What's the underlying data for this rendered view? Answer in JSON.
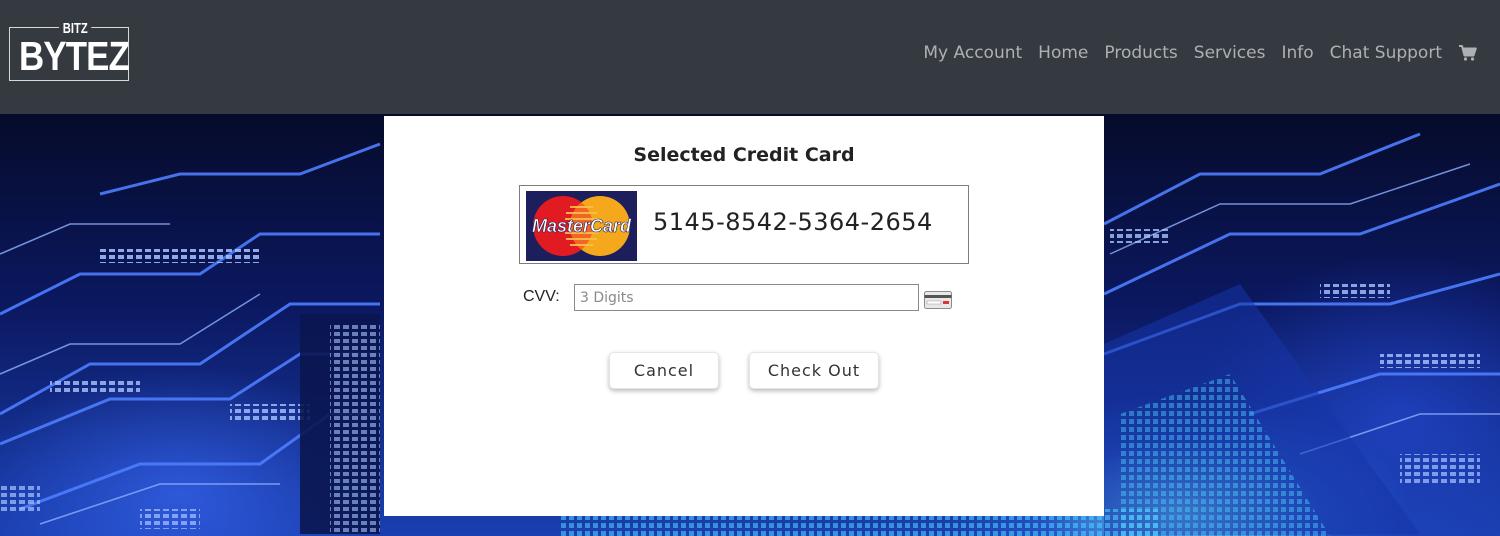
{
  "brand": {
    "logo_top": "BITZ",
    "logo_main": "BYTEZ"
  },
  "nav": {
    "items": [
      {
        "label": "My Account",
        "name": "nav-my-account"
      },
      {
        "label": "Home",
        "name": "nav-home"
      },
      {
        "label": "Products",
        "name": "nav-products"
      },
      {
        "label": "Services",
        "name": "nav-services"
      },
      {
        "label": "Info",
        "name": "nav-info"
      },
      {
        "label": "Chat Support",
        "name": "nav-chat-support"
      }
    ],
    "cart_icon": "shopping-cart-icon",
    "text_color": "#adb0b4",
    "bg_color": "#343a40"
  },
  "modal": {
    "title": "Selected Credit Card",
    "card": {
      "brand_logo": "MasterCard",
      "number": "5145-8542-5364-2654"
    },
    "cvv": {
      "label": "CVV:",
      "value": "",
      "placeholder": "3 Digits",
      "icon": "credit-card-icon"
    },
    "buttons": {
      "cancel_label": "Cancel",
      "checkout_label": "Check Out"
    }
  },
  "background": {
    "description_icon": "circuit-board-background"
  }
}
